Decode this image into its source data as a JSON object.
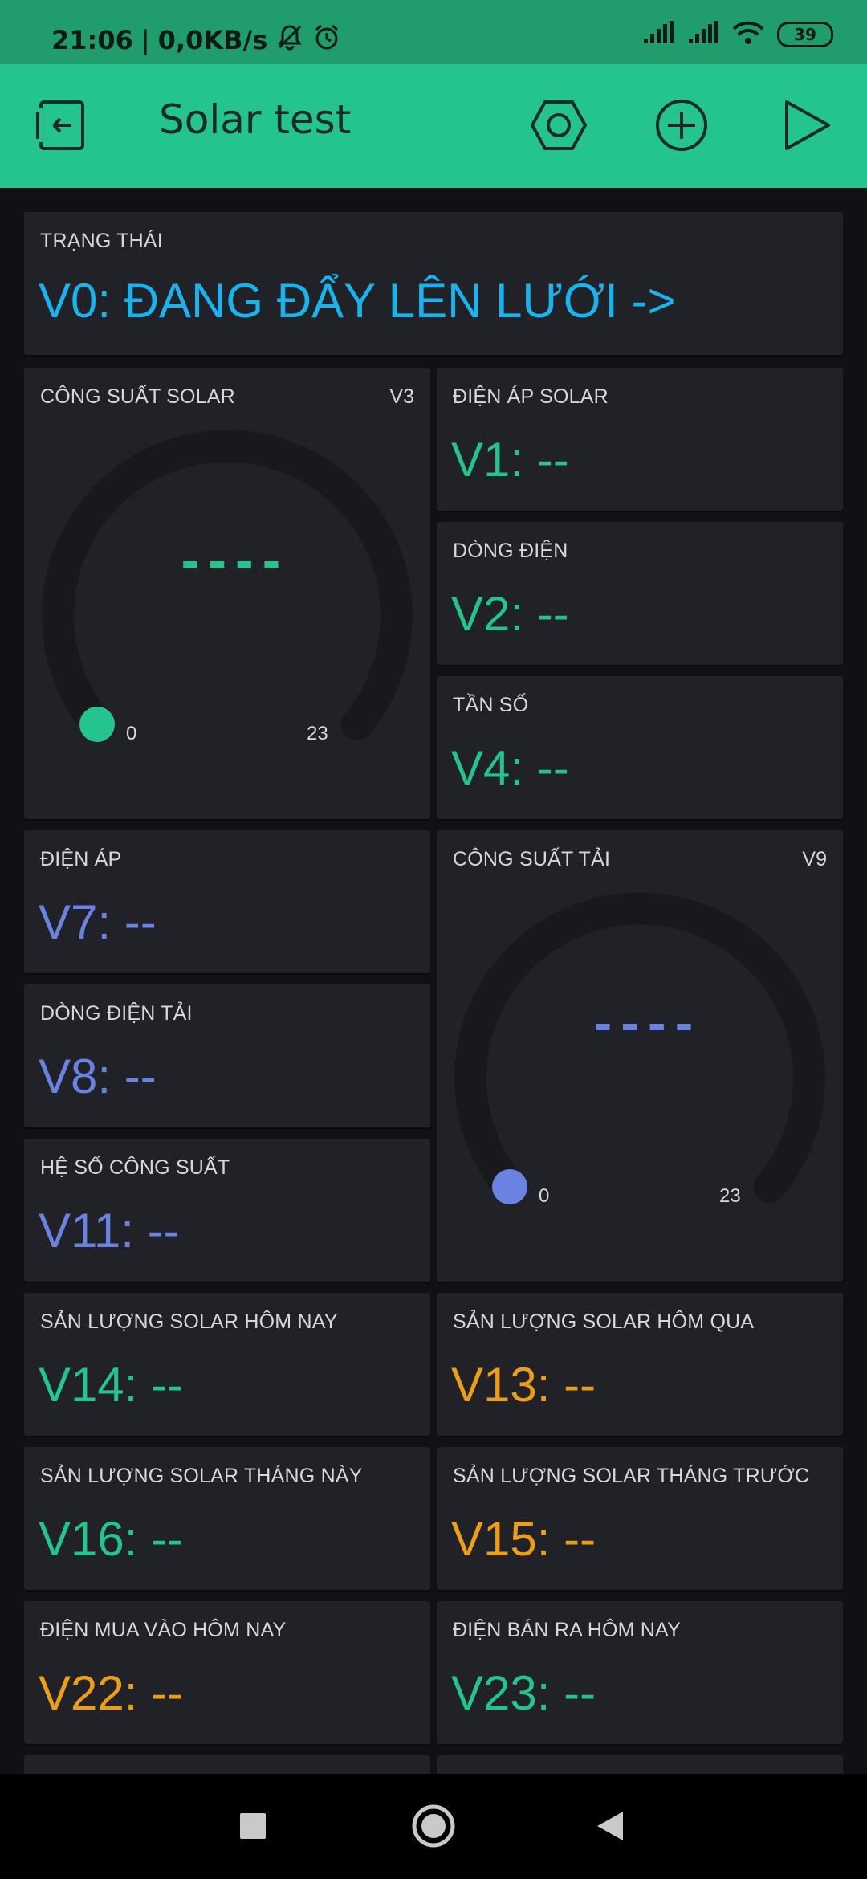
{
  "status_bar": {
    "time": "21:06",
    "separator": "|",
    "net_speed": "0,0KB/s",
    "battery": "39",
    "icons": [
      "mute-bell-icon",
      "alarm-icon",
      "signal-icon",
      "signal-icon",
      "wifi-icon",
      "battery-icon"
    ]
  },
  "toolbar": {
    "title": "Solar test",
    "background": "#23c48e",
    "icons": [
      "exit-icon",
      "hexagon-settings-icon",
      "add-icon",
      "play-icon"
    ]
  },
  "colors": {
    "blue": "#17b4ef",
    "green": "#23c48e",
    "violet": "#6a83e3",
    "orange": "#ec9f16",
    "widget_bg": "#212227"
  },
  "widgets": {
    "status": {
      "label": "TRẠNG THÁI",
      "value": "V0: ĐANG ĐẨY LÊN LƯỚI ->",
      "color": "#17b4ef"
    },
    "solar_power_gauge": {
      "label": "CÔNG SUẤT SOLAR",
      "pin": "V3",
      "value": "----",
      "min": "0",
      "max": "23",
      "level": 0,
      "color": "#23c48e"
    },
    "solar_voltage": {
      "label": "ĐIỆN ÁP SOLAR",
      "value": "V1: --",
      "color": "#23c48e"
    },
    "current": {
      "label": "DÒNG ĐIỆN",
      "value": "V2: --",
      "color": "#23c48e"
    },
    "frequency": {
      "label": "TẦN SỐ",
      "value": "V4: --",
      "color": "#23c48e"
    },
    "voltage": {
      "label": "ĐIỆN ÁP",
      "value": "V7: --",
      "color": "#6a83e3"
    },
    "load_power_gauge": {
      "label": "CÔNG SUẤT TẢI",
      "pin": "V9",
      "value": "----",
      "min": "0",
      "max": "23",
      "level": 0,
      "color": "#6a83e3"
    },
    "load_current": {
      "label": "DÒNG ĐIỆN TẢI",
      "value": "V8: --",
      "color": "#6a83e3"
    },
    "power_factor": {
      "label": "HỆ SỐ CÔNG SUẤT",
      "value": "V11: --",
      "color": "#6a83e3"
    },
    "solar_today": {
      "label": "SẢN LƯỢNG SOLAR HÔM NAY",
      "value": "V14: --",
      "color": "#23c48e"
    },
    "solar_yesterday": {
      "label": "SẢN LƯỢNG SOLAR HÔM QUA",
      "value": "V13: --",
      "color": "#ec9f16"
    },
    "solar_this_month": {
      "label": "SẢN LƯỢNG SOLAR THÁNG NÀY",
      "value": "V16: --",
      "color": "#23c48e"
    },
    "solar_last_month": {
      "label": "SẢN LƯỢNG SOLAR THÁNG TRƯỚC",
      "value": "V15: --",
      "color": "#ec9f16"
    },
    "bought_today": {
      "label": "ĐIỆN MUA VÀO HÔM NAY",
      "value": "V22: --",
      "color": "#ec9f16"
    },
    "sold_today": {
      "label": "ĐIỆN BÁN RA HÔM NAY",
      "value": "V23: --",
      "color": "#23c48e"
    }
  },
  "nav_bar": {
    "icons": [
      "recents-square-icon",
      "home-circle-icon",
      "back-triangle-icon"
    ]
  }
}
